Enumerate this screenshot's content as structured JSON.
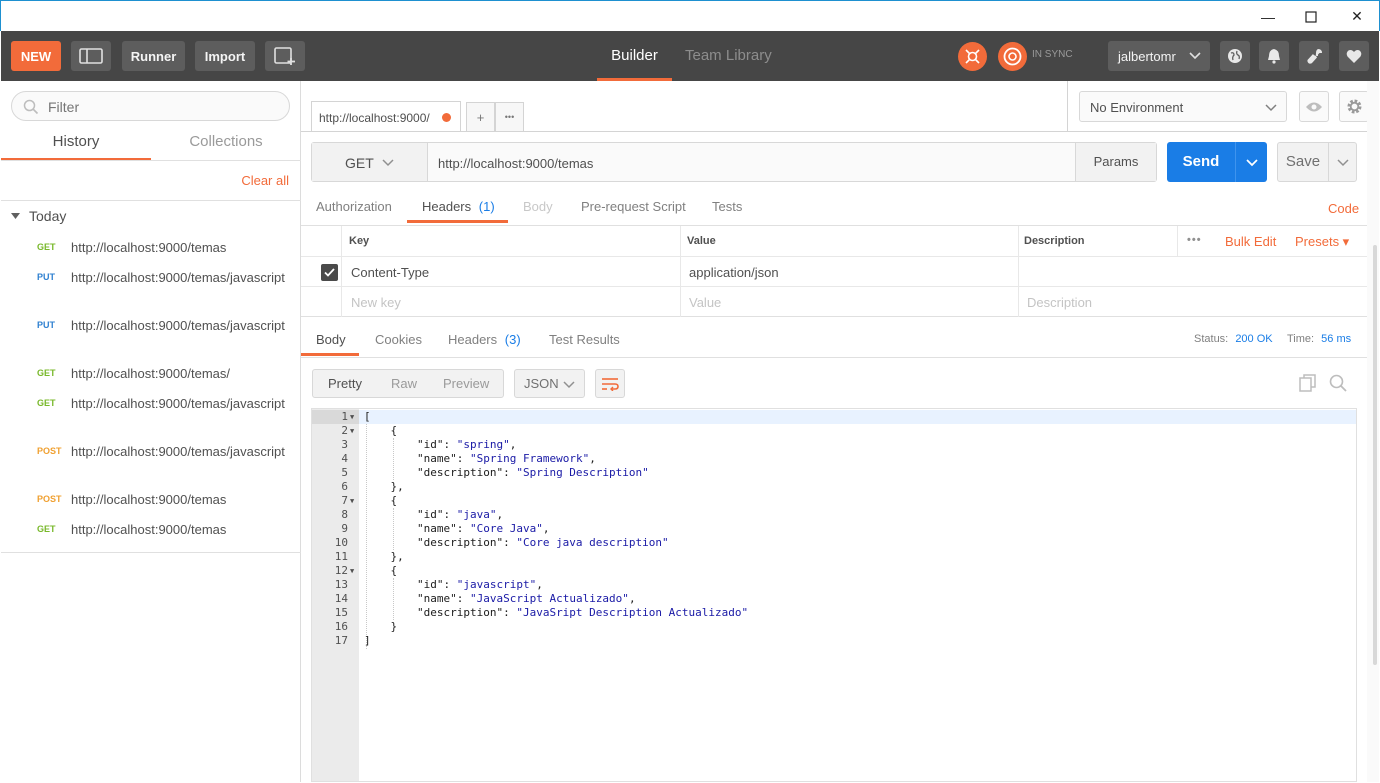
{
  "window": {
    "minimize": "—",
    "maximize": "☐",
    "close": "✕"
  },
  "toolbar": {
    "new_label": "NEW",
    "runner_label": "Runner",
    "import_label": "Import",
    "tabs": [
      {
        "label": "Builder"
      },
      {
        "label": "Team Library"
      }
    ],
    "sync_status": "IN SYNC",
    "user": "jalbertomr"
  },
  "sidebar": {
    "filter_placeholder": "Filter",
    "tabs": [
      {
        "label": "History"
      },
      {
        "label": "Collections"
      }
    ],
    "clear_all": "Clear all",
    "group": "Today",
    "history": [
      {
        "method": "GET",
        "url": "http://localhost:9000/temas"
      },
      {
        "method": "PUT",
        "url": "http://localhost:9000/temas/javascript"
      },
      {
        "method": "PUT",
        "url": "http://localhost:9000/temas/javascript"
      },
      {
        "method": "GET",
        "url": "http://localhost:9000/temas/"
      },
      {
        "method": "GET",
        "url": "http://localhost:9000/temas/javascript"
      },
      {
        "method": "POST",
        "url": "http://localhost:9000/temas/javascript"
      },
      {
        "method": "POST",
        "url": "http://localhost:9000/temas"
      },
      {
        "method": "GET",
        "url": "http://localhost:9000/temas"
      }
    ],
    "method_colors": {
      "GET": "#78b82a",
      "PUT": "#2f80d0",
      "POST": "#f0a030"
    }
  },
  "request_tab": {
    "label": "http://localhost:9000/",
    "add": "+",
    "more": "•••"
  },
  "environment": {
    "label": "No Environment"
  },
  "request": {
    "method": "GET",
    "url": "http://localhost:9000/temas",
    "params_label": "Params",
    "send_label": "Send",
    "save_label": "Save",
    "tabs": {
      "authorization": "Authorization",
      "headers": "Headers",
      "headers_count": "(1)",
      "body": "Body",
      "prerequest": "Pre-request Script",
      "tests": "Tests"
    },
    "code_label": "Code"
  },
  "headers_table": {
    "columns": {
      "key": "Key",
      "value": "Value",
      "description": "Description"
    },
    "more": "•••",
    "bulk_edit": "Bulk Edit",
    "presets": "Presets ▾",
    "rows": [
      {
        "key": "Content-Type",
        "value": "application/json",
        "checked": true
      }
    ],
    "placeholders": {
      "key": "New key",
      "value": "Value",
      "description": "Description"
    }
  },
  "response": {
    "tabs": {
      "body": "Body",
      "cookies": "Cookies",
      "headers": "Headers",
      "headers_count": "(3)",
      "test_results": "Test Results"
    },
    "status_label": "Status:",
    "status_value": "200 OK",
    "time_label": "Time:",
    "time_value": "56 ms",
    "views": {
      "pretty": "Pretty",
      "raw": "Raw",
      "preview": "Preview"
    },
    "format": "JSON",
    "lines": [
      "[",
      "    {",
      "        \"id\": \"spring\",",
      "        \"name\": \"Spring Framework\",",
      "        \"description\": \"Spring Description\"",
      "    },",
      "    {",
      "        \"id\": \"java\",",
      "        \"name\": \"Core Java\",",
      "        \"description\": \"Core java description\"",
      "    },",
      "    {",
      "        \"id\": \"javascript\",",
      "        \"name\": \"JavaScript Actualizado\",",
      "        \"description\": \"JavaSript Description Actualizado\"",
      "    }",
      "]"
    ],
    "foldable_lines": [
      1,
      2,
      7,
      12
    ]
  }
}
